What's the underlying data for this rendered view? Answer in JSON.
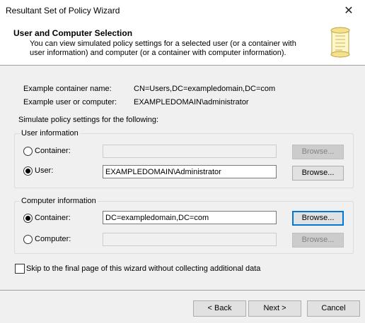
{
  "window": {
    "title": "Resultant Set of Policy Wizard",
    "close_glyph": "✕"
  },
  "header": {
    "title": "User and Computer Selection",
    "description": "You can view simulated policy settings for a selected user (or a container with user information) and computer (or a container with computer information).",
    "icon": "scroll-icon"
  },
  "examples": {
    "container_label": "Example container name:",
    "container_value": "CN=Users,DC=exampledomain,DC=com",
    "user_label": "Example user or computer:",
    "user_value": "EXAMPLEDOMAIN\\administrator"
  },
  "simulate_label": "Simulate policy settings for the following:",
  "user_info": {
    "group_label": "User information",
    "container_radio": "Container:",
    "container_value": "",
    "container_browse": "Browse...",
    "user_radio": "User:",
    "user_value": "EXAMPLEDOMAIN\\Administrator",
    "user_browse": "Browse...",
    "selected": "user"
  },
  "computer_info": {
    "group_label": "Computer information",
    "container_radio": "Container:",
    "container_value": "DC=exampledomain,DC=com",
    "container_browse": "Browse...",
    "computer_radio": "Computer:",
    "computer_value": "",
    "computer_browse": "Browse...",
    "selected": "container"
  },
  "skip_checkbox": {
    "label": "Skip to the final page of this wizard without collecting additional data",
    "checked": false
  },
  "buttons": {
    "back": "< Back",
    "next": "Next >",
    "cancel": "Cancel"
  }
}
